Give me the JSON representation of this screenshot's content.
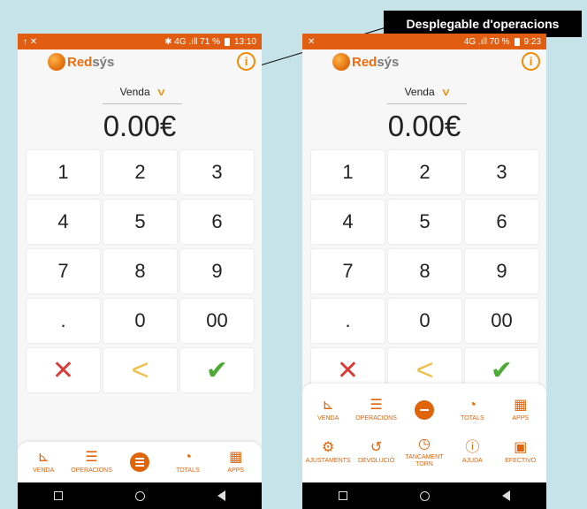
{
  "callout": {
    "text": "Desplegable d'operacions"
  },
  "left": {
    "status": {
      "left_icons": "↑ ✕",
      "right": "✱ 4G .ıll 71 %",
      "time": "13:10"
    },
    "logo": {
      "part1": "Red",
      "part2": "sýs"
    },
    "operation": "Venda",
    "amount": "0.00€",
    "keys": [
      "1",
      "2",
      "3",
      "4",
      "5",
      "6",
      "7",
      "8",
      "9",
      ".",
      "0",
      "00"
    ],
    "action_keys": {
      "cancel": "✕",
      "back": "<",
      "ok": "✔"
    },
    "menu": [
      {
        "label": "VENDA",
        "icon": "sale-chart-icon"
      },
      {
        "label": "OPERACIONS",
        "icon": "operations-doc-icon"
      },
      {
        "label": "",
        "icon": "menu-expand-icon"
      },
      {
        "label": "TOTALS",
        "icon": "pie-chart-icon"
      },
      {
        "label": "APPS",
        "icon": "apps-grid-icon"
      }
    ]
  },
  "right": {
    "status": {
      "left_icons": "✕",
      "right": "4G .ıll 70 %",
      "time": "9:23"
    },
    "logo": {
      "part1": "Red",
      "part2": "sýs"
    },
    "operation": "Venda",
    "amount": "0.00€",
    "keys": [
      "1",
      "2",
      "3",
      "4",
      "5",
      "6",
      "7",
      "8",
      "9",
      ".",
      "0",
      "00"
    ],
    "action_keys": {
      "cancel": "✕",
      "back": "<",
      "ok": "✔"
    },
    "menu_row1": [
      {
        "label": "VENDA",
        "icon": "sale-chart-icon"
      },
      {
        "label": "OPERACIONS",
        "icon": "operations-doc-icon"
      },
      {
        "label": "",
        "icon": "menu-collapse-icon"
      },
      {
        "label": "TOTALS",
        "icon": "pie-chart-icon"
      },
      {
        "label": "APPS",
        "icon": "apps-grid-icon"
      }
    ],
    "menu_row2": [
      {
        "label": "AJUSTAMENTS",
        "icon": "gear-icon"
      },
      {
        "label": "DEVOLUCIÓ",
        "icon": "refund-icon"
      },
      {
        "label": "TANCAMENT TORN",
        "icon": "clock-icon"
      },
      {
        "label": "AJUDA",
        "icon": "info-icon"
      },
      {
        "label": "EFECTIVO",
        "icon": "cash-register-icon"
      }
    ]
  },
  "colors": {
    "accent": "#e0640a",
    "status_bar": "#e05d12",
    "background": "#c6e3ea",
    "cancel": "#d93b36",
    "back": "#ecc04a",
    "ok": "#4dab35"
  }
}
